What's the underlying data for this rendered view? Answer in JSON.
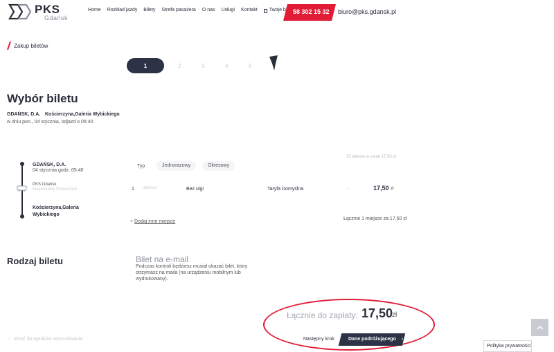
{
  "header": {
    "logo_main": "PKS",
    "logo_sub": "Gdańsk",
    "nav": [
      "Home",
      "Rozkład jazdy",
      "Bilety",
      "Strefa pasażera",
      "O nas",
      "Usługi",
      "Kontakt"
    ],
    "my_tickets": "Twoje bilety",
    "phone": "58 302 15 32",
    "email": "biuro@pks.gdansk.pl"
  },
  "breadcrumb": "Zakup biletów",
  "steps": [
    "1",
    "2",
    "3",
    "4",
    "5"
  ],
  "section": {
    "title": "Wybór biletu",
    "from": "GDAŃSK, D.A.",
    "to": "Kościerzyna,Galeria Wybickiego",
    "date": "w dniu pon., 04 stycznia, odjazd o 05:40"
  },
  "trip": {
    "seats_info": "15 biletów w cenie 17,50 zł",
    "stop1_name": "GDAŃSK, D.A.",
    "stop1_time": "04 stycznia godz. 05:40",
    "carrier": "PKS Gdańsk",
    "carrier_sub": "Ekspresowy Przewoźnik",
    "stop2_name": "Kościerzyna,Galeria Wybickiego",
    "type_label": "Typ",
    "type_options": [
      "Jednorazowy",
      "Okresowy"
    ],
    "row": {
      "count": "1",
      "seat": "miejsce",
      "discount": "Bez ulgi",
      "tariff": "Taryfa Domyślna",
      "dash": "-",
      "price": "17,50",
      "currency": "zł"
    },
    "add_seat_prefix": "+",
    "add_seat": "Dodaj inne miejsce",
    "total_small": "Łącznie 1 miejsce za 17,50 zł"
  },
  "ticket_kind": {
    "title": "Rodzaj biletu",
    "email_title": "Bilet na e-mail",
    "email_desc": "Podczas kontroli będziesz musiał okazać bilet, który otrzymasz na maila (na urządzeniu mobilnym lub wydrukowany)."
  },
  "summary": {
    "label": "Łącznie do zapłaty:",
    "value": "17,50",
    "currency": "zł",
    "next_label": "Następny krok",
    "next_button": "Dane podróżującego",
    "back_link": "Wróć do wyników wyszukiwania",
    "privacy": "Polityka prywatności"
  },
  "colors": {
    "accent": "#e11d36",
    "dark": "#2c3347"
  }
}
